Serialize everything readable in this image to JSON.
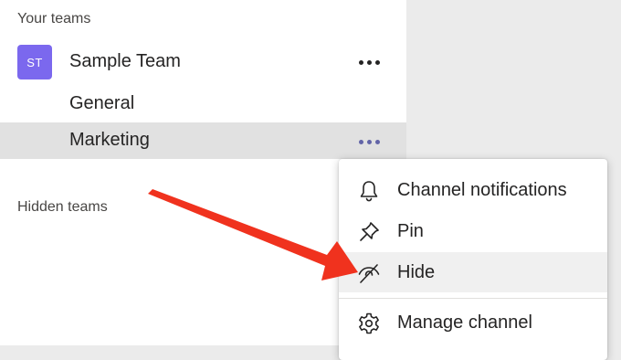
{
  "sidebar": {
    "your_teams_header": "Your teams",
    "team": {
      "initials": "ST",
      "name": "Sample Team",
      "avatar_color": "#7b68ee"
    },
    "channels": [
      {
        "name": "General"
      },
      {
        "name": "Marketing",
        "selected": true
      }
    ],
    "hidden_teams_header": "Hidden teams"
  },
  "context_menu": {
    "items": [
      {
        "label": "Channel notifications",
        "icon": "bell-icon"
      },
      {
        "label": "Pin",
        "icon": "pin-icon"
      },
      {
        "label": "Hide",
        "icon": "eye-off-icon",
        "hovered": true
      },
      {
        "label": "Manage channel",
        "icon": "gear-icon"
      }
    ]
  },
  "colors": {
    "accent": "#6264a7",
    "annotation_arrow": "#f0321e",
    "selected_row": "#e1e1e1"
  }
}
